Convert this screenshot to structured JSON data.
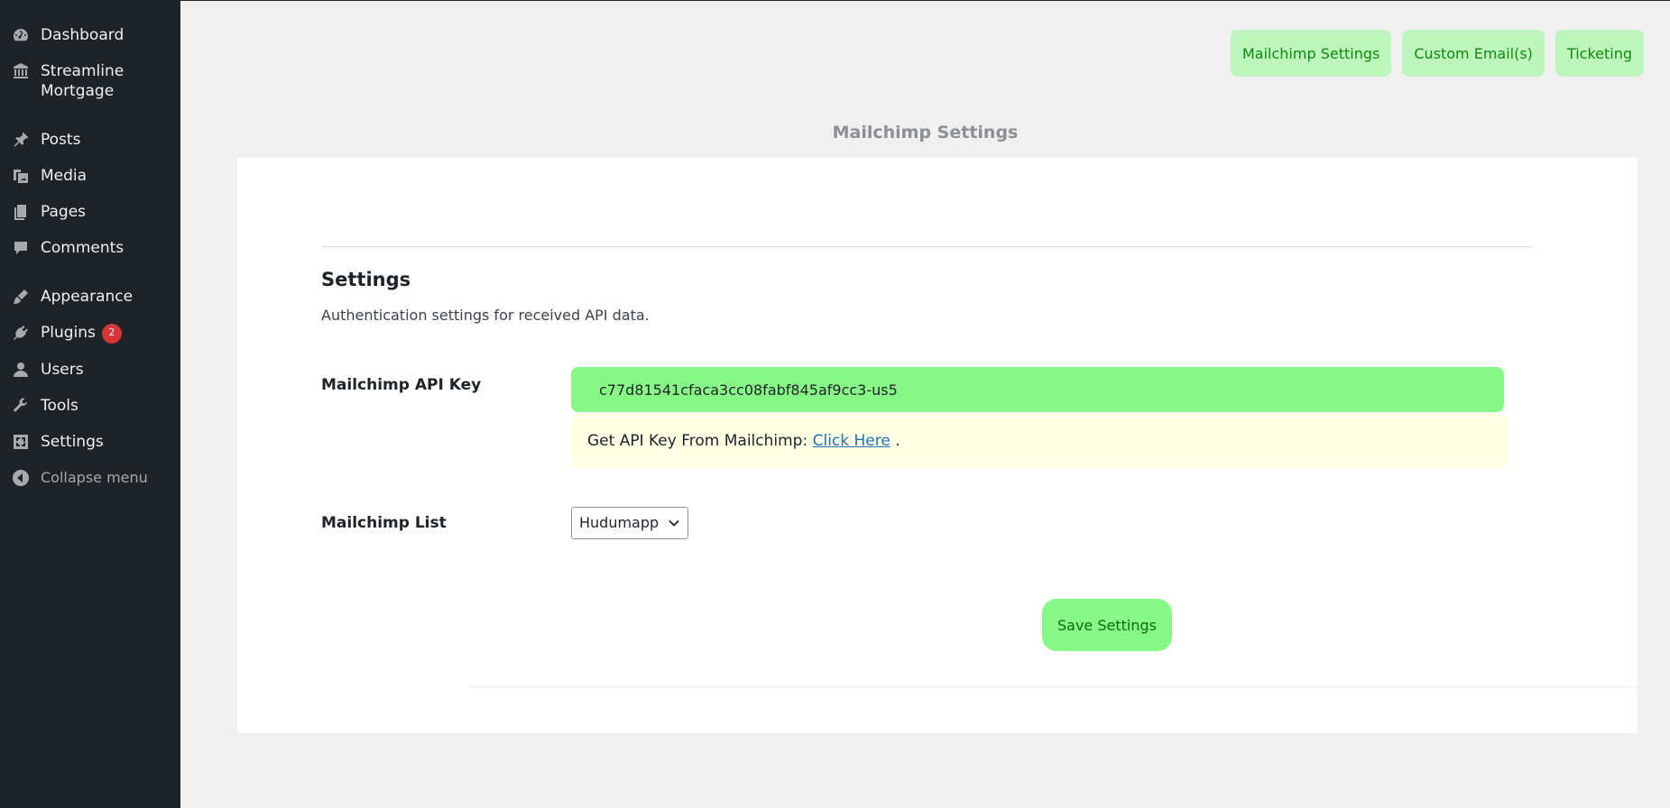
{
  "sidebar": {
    "items": [
      {
        "label": "Dashboard",
        "icon": "dashboard-icon"
      },
      {
        "label": "Streamline Mortgage",
        "icon": "bank-icon"
      },
      {
        "label": "Posts",
        "icon": "pin-icon"
      },
      {
        "label": "Media",
        "icon": "media-icon"
      },
      {
        "label": "Pages",
        "icon": "pages-icon"
      },
      {
        "label": "Comments",
        "icon": "comment-icon"
      },
      {
        "label": "Appearance",
        "icon": "paintbrush-icon"
      },
      {
        "label": "Plugins",
        "icon": "plugin-icon",
        "badge": "2"
      },
      {
        "label": "Users",
        "icon": "user-icon"
      },
      {
        "label": "Tools",
        "icon": "wrench-icon"
      },
      {
        "label": "Settings",
        "icon": "settings-icon"
      }
    ],
    "collapse_label": "Collapse menu"
  },
  "top_nav": {
    "mailchimp": "Mailchimp Settings",
    "custom_email": "Custom Email(s)",
    "ticketing": "Ticketing"
  },
  "page_title": "Mailchimp Settings",
  "settings": {
    "title": "Settings",
    "description": "Authentication settings for received API data.",
    "api_key_label": "Mailchimp API Key",
    "api_key_value": "c77d81541cfaca3cc08fabf845af9cc3-us5",
    "notice_prefix": "Get API Key From Mailchimp: ",
    "notice_link": "Click Here",
    "notice_suffix": " .",
    "list_label": "Mailchimp List",
    "list_selected": "Hudumapp",
    "save_label": "Save Settings"
  },
  "colors": {
    "sidebar_bg": "#1d2327",
    "accent_green": "#87f887",
    "nav_button_bg": "#bdf5bd",
    "badge_red": "#d63638",
    "link_blue": "#2271b1"
  }
}
